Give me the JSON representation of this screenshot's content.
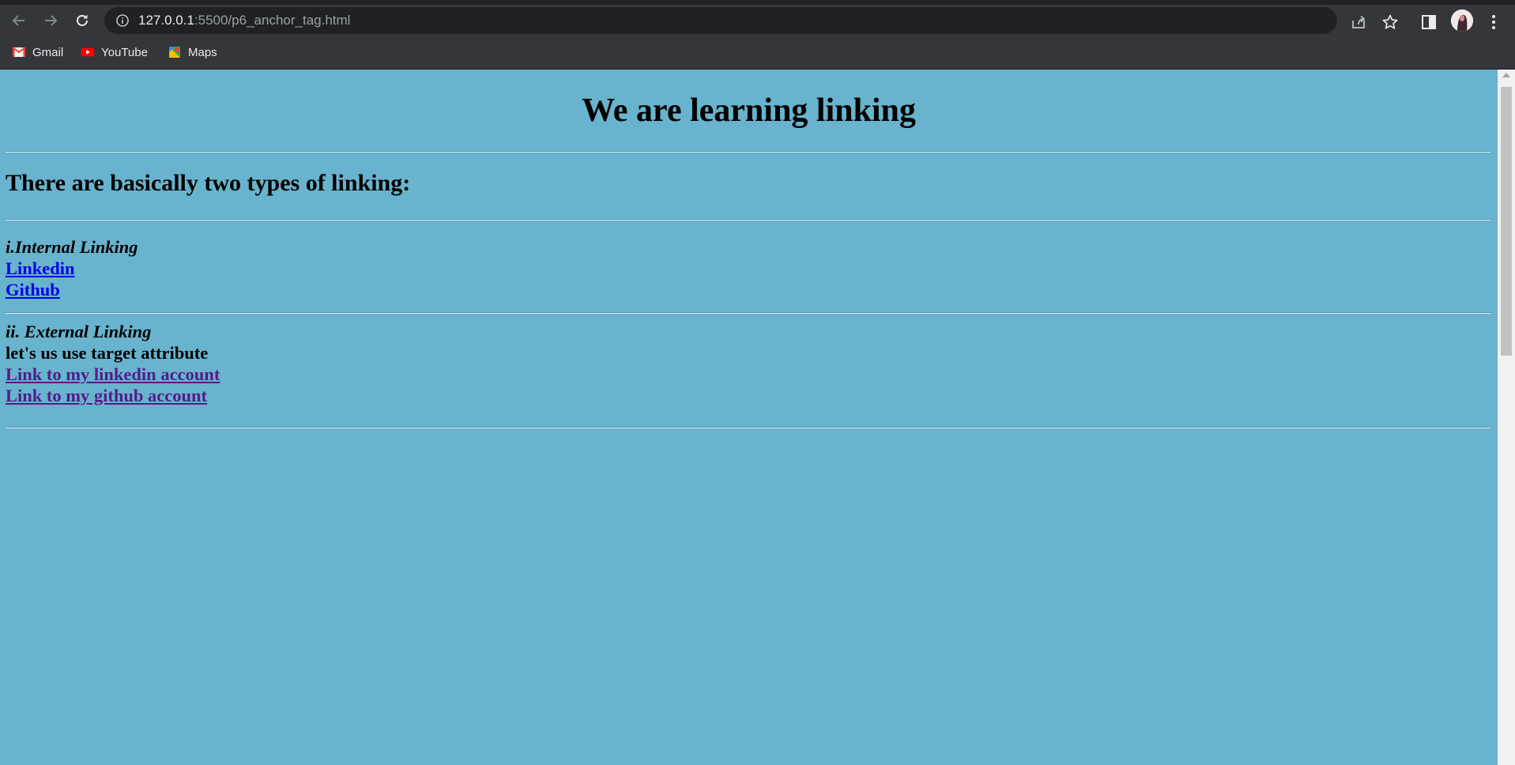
{
  "browser": {
    "url_host": "127.0.0.1",
    "url_path": ":5500/p6_anchor_tag.html",
    "bookmarks": [
      {
        "label": "Gmail",
        "icon": "gmail-icon"
      },
      {
        "label": "YouTube",
        "icon": "youtube-icon"
      },
      {
        "label": "Maps",
        "icon": "maps-icon"
      }
    ]
  },
  "page": {
    "heading": "We are learning linking",
    "subheading": "There are basically two types of linking:",
    "internal": {
      "title": "i.Internal Linking",
      "links": [
        "Linkedin",
        "Github"
      ]
    },
    "external": {
      "title": "ii. External Linking",
      "note": "let's us use target attribute",
      "links": [
        "Link to my linkedin account",
        "Link to my github account"
      ]
    }
  },
  "colors": {
    "page_background": "#68b3cd",
    "link_unvisited": "#0000ee",
    "link_visited": "#551a8b",
    "chrome_background": "#35363a",
    "omnibox_background": "#202124"
  }
}
